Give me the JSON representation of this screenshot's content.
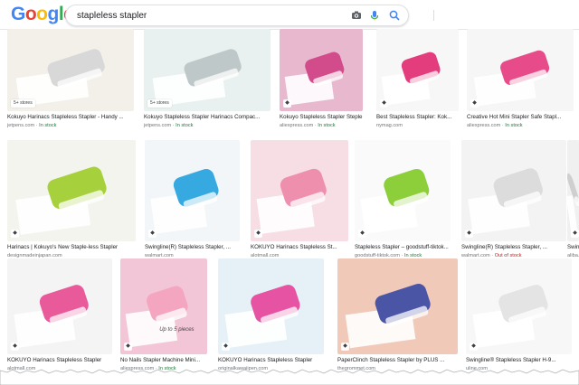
{
  "header": {
    "logo_letters": [
      {
        "ch": "G",
        "color": "#4285F4"
      },
      {
        "ch": "o",
        "color": "#EA4335"
      },
      {
        "ch": "o",
        "color": "#FBBC05"
      },
      {
        "ch": "g",
        "color": "#4285F4"
      },
      {
        "ch": "l",
        "color": "#34A853"
      },
      {
        "ch": "e",
        "color": "#EA4335"
      }
    ],
    "search_value": "stapleless stapler",
    "icons": [
      "camera-icon",
      "mic-icon",
      "search-icon"
    ]
  },
  "results": [
    {
      "caption": "Kokuyo Harinacs Stapleless Stapler - Handy ...",
      "source": "jetpens.com",
      "stock": "In stock",
      "badge": "5+ stores",
      "colors": [
        "#f3f0ea",
        "#d8d8d8"
      ]
    },
    {
      "caption": "Kokuyo Stapleless Stapler Harinacs Compac...",
      "source": "jetpens.com",
      "stock": "In stock",
      "badge": "5+ stores",
      "colors": [
        "#e9f0f0",
        "#bfc8c8"
      ]
    },
    {
      "caption": "Kokuyo Stapleless Stapler Steple Pa...",
      "source": "aliexpress.com",
      "stock": "In stock",
      "colors": [
        "#e8b8cf",
        "#d24b8a"
      ]
    },
    {
      "caption": "Best Stapleless Stapler: Kok...",
      "source": "nymag.com",
      "stock": "",
      "colors": [
        "#f7f7f7",
        "#e33d7e"
      ]
    },
    {
      "caption": "Creative Hot Mini Stapler Safe Stapl...",
      "source": "aliexpress.com",
      "stock": "In stock",
      "colors": [
        "#f6f6f6",
        "#e84b8a"
      ]
    },
    {
      "caption": "Harinacs | Kokuyo's New Staple-less Stapler",
      "source": "designmadeinjapan.com",
      "stock": "",
      "colors": [
        "#f4f4ee",
        "#a7d13c"
      ]
    },
    {
      "caption": "Swingline(R) Stapleless Stapler, ...",
      "source": "walmart.com",
      "stock": "",
      "colors": [
        "#f2f6f8",
        "#36a9e1"
      ]
    },
    {
      "caption": "KOKUYO Harinacs Stapleless St...",
      "source": "alotmall.com",
      "stock": "",
      "colors": [
        "#f7dde4",
        "#ef8fae"
      ]
    },
    {
      "caption": "Stapleless Stapler – goodstuff-tiktok...",
      "source": "goodstuff-tiktok.com",
      "stock": "In stock",
      "colors": [
        "#fafafa",
        "#8ccf3a"
      ]
    },
    {
      "caption": "Swingline(R) Stapleless Stapler, ...",
      "source": "walmart.com",
      "stock": "Out of stock",
      "colors": [
        "#f3f3f3",
        "#dcdcdc"
      ]
    },
    {
      "caption": "Swingl...",
      "source": "aliba...",
      "stock": "",
      "colors": [
        "#f0f0f0",
        "#cfcfcf"
      ]
    },
    {
      "caption": "KOKUYO Harinacs Stapleless Stapler",
      "source": "alotmall.com",
      "stock": "",
      "colors": [
        "#f4f4f4",
        "#e85a9a"
      ]
    },
    {
      "caption": "No Nails Stapler Machine Mini...",
      "source": "aliexpress.com",
      "stock": "In stock",
      "overlay": "Up to 5 pieces",
      "colors": [
        "#f2c6d6",
        "#f4a6c0"
      ]
    },
    {
      "caption": "KOKUYO Harinacs Stapleless Stapler",
      "source": "originalkawaiipen.com",
      "stock": "",
      "colors": [
        "#e5f1f6",
        "#e653a2"
      ]
    },
    {
      "caption": "PaperClinch Stapleless Stapler by PLUS ...",
      "source": "thegrommet.com",
      "stock": "",
      "colors": [
        "#f0c9b8",
        "#4b55a6"
      ]
    },
    {
      "caption": "Swingline® Stapleless Stapler H-9...",
      "source": "uline.com",
      "stock": "",
      "colors": [
        "#f7f7f7",
        "#e4e4e4"
      ]
    }
  ]
}
